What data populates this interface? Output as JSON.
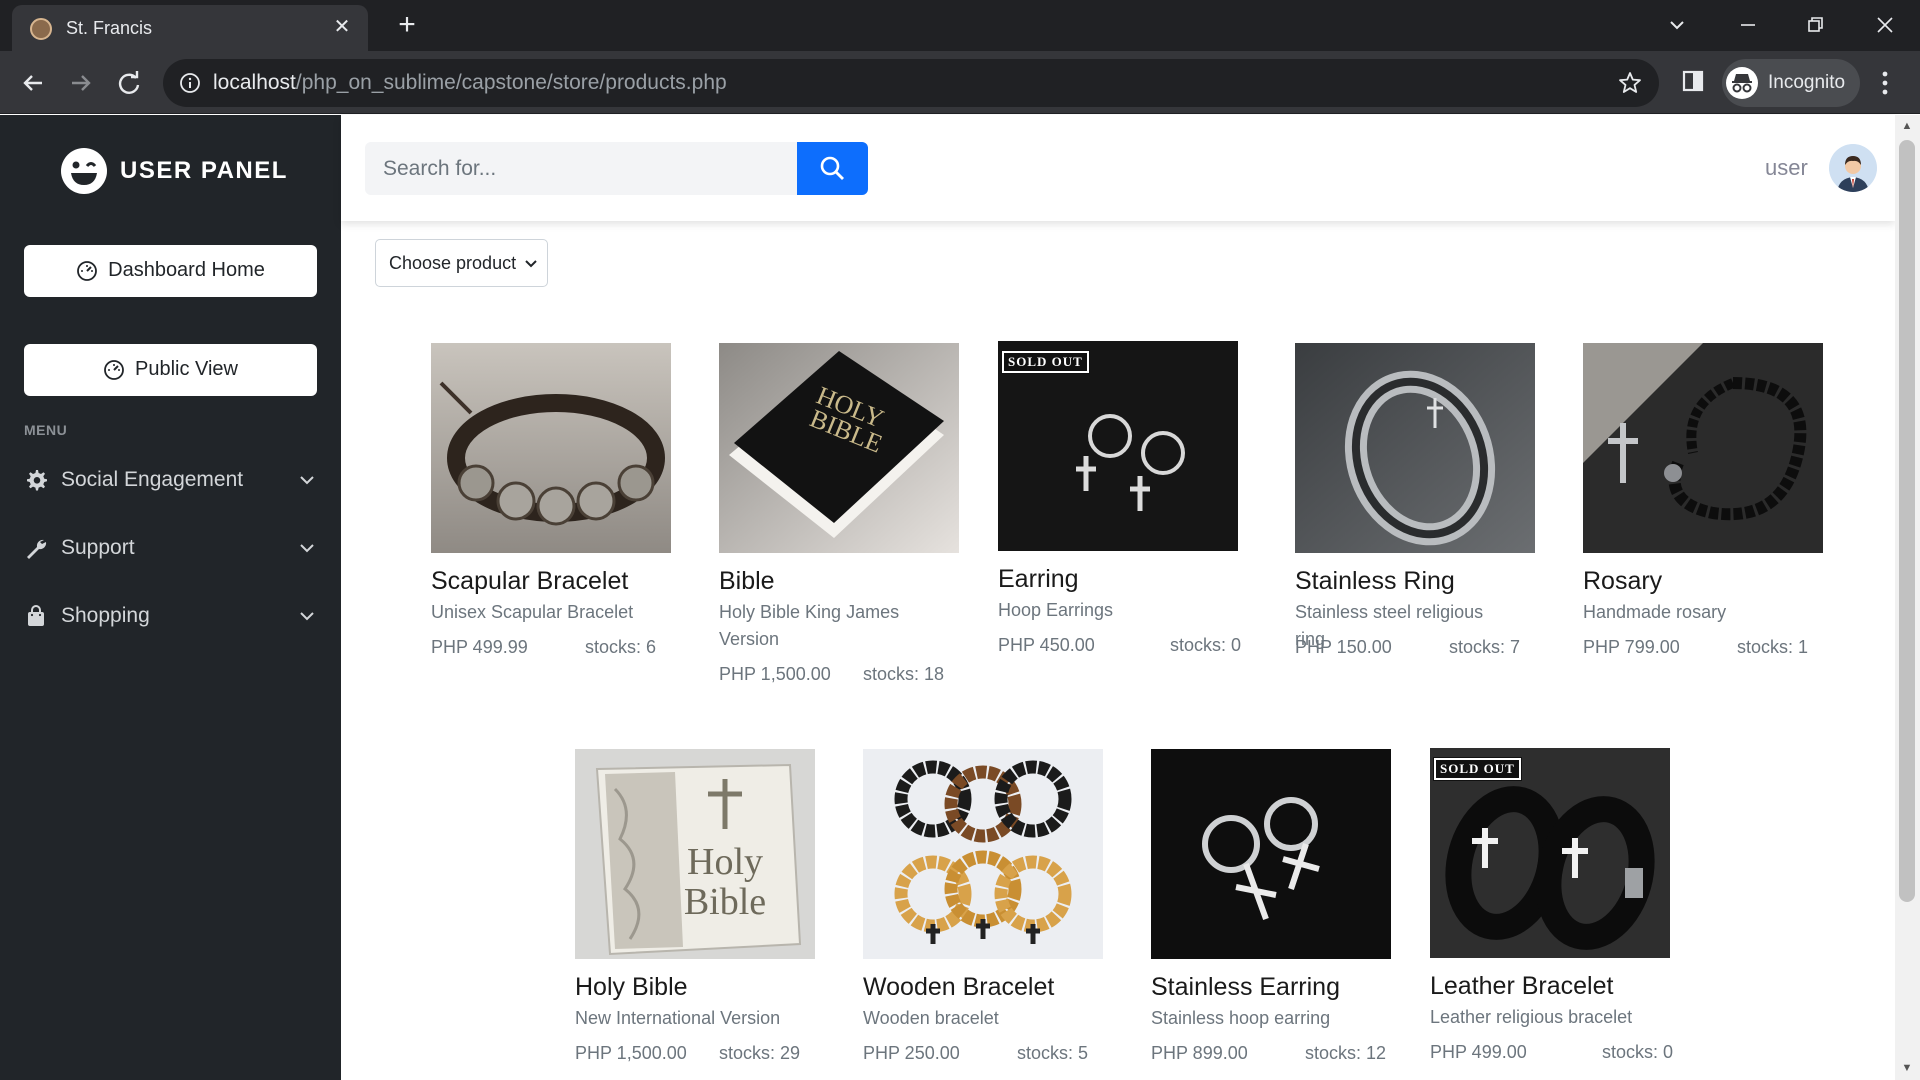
{
  "browser": {
    "tab_title": "St. Francis",
    "url_host": "localhost",
    "url_path": "/php_on_sublime/capstone/store/products.php",
    "profile_label": "Incognito"
  },
  "sidebar": {
    "brand": "USER PANEL",
    "buttons": [
      {
        "label": "Dashboard Home",
        "icon": "speedometer-icon"
      },
      {
        "label": "Public View",
        "icon": "speedometer-icon"
      }
    ],
    "menu_heading": "MENU",
    "menu": [
      {
        "label": "Social Engagement",
        "icon": "gear-icon"
      },
      {
        "label": "Support",
        "icon": "wrench-icon"
      },
      {
        "label": "Shopping",
        "icon": "shopping-bag-icon"
      }
    ]
  },
  "topbar": {
    "search_placeholder": "Search for...",
    "user_name": "user"
  },
  "filter": {
    "selected": "Choose product"
  },
  "products": [
    {
      "name": "Scapular Bracelet",
      "desc": "Unisex Scapular Bracelet",
      "price": "PHP 499.99",
      "stock": "stocks: 6",
      "sold_out": false
    },
    {
      "name": "Bible",
      "desc": "Holy Bible King James Version",
      "price": "PHP 1,500.00",
      "stock": "stocks: 18",
      "sold_out": false
    },
    {
      "name": "Earring",
      "desc": "Hoop Earrings",
      "price": "PHP 450.00",
      "stock": "stocks: 0",
      "sold_out": true,
      "badge": "SOLD OUT"
    },
    {
      "name": "Stainless Ring",
      "desc": "Stainless steel religious ring",
      "price": "PHP 150.00",
      "stock": "stocks: 7",
      "sold_out": false
    },
    {
      "name": "Rosary",
      "desc": "Handmade rosary",
      "price": "PHP 799.00",
      "stock": "stocks: 1",
      "sold_out": false
    },
    {
      "name": "Holy Bible",
      "desc": "New International Version",
      "price": "PHP 1,500.00",
      "stock": "stocks: 29",
      "sold_out": false,
      "cover_text_1": "Holy",
      "cover_text_2": "Bible"
    },
    {
      "name": "Wooden Bracelet",
      "desc": "Wooden bracelet",
      "price": "PHP 250.00",
      "stock": "stocks: 5",
      "sold_out": false
    },
    {
      "name": "Stainless Earring",
      "desc": "Stainless hoop earring",
      "price": "PHP 899.00",
      "stock": "stocks: 12",
      "sold_out": false
    },
    {
      "name": "Leather Bracelet",
      "desc": "Leather religious bracelet",
      "price": "PHP 499.00",
      "stock": "stocks: 0",
      "sold_out": true,
      "badge": "SOLD OUT"
    }
  ],
  "bible_cover": {
    "line1": "HOLY",
    "line2": "BIBLE"
  },
  "colors": {
    "sidebar": "#212529",
    "primary": "#0d6efd",
    "chrome": "#35363a"
  }
}
